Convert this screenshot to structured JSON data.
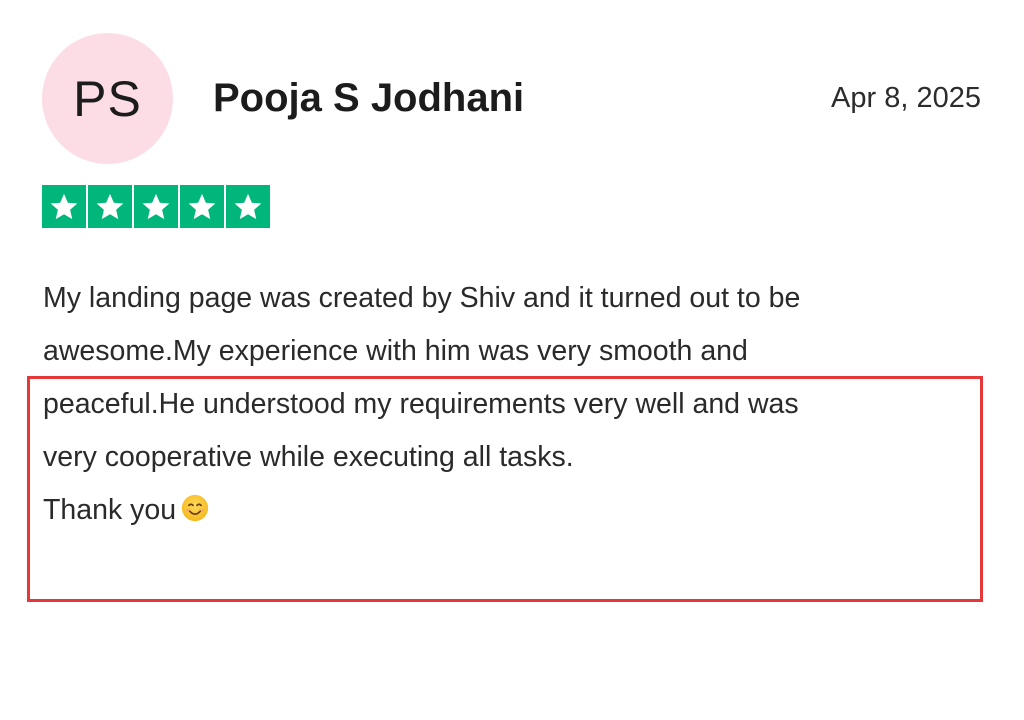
{
  "reviewer": {
    "initials": "PS",
    "name": "Pooja S Jodhani",
    "avatar_color": "#fcdde6"
  },
  "review": {
    "date": "Apr 8, 2025",
    "rating": 5,
    "rating_max": 5,
    "star_color": "#00b67a",
    "lines": [
      "My landing page was created by Shiv and it turned out to be",
      "awesome.My experience with him was very smooth and",
      "peaceful.He understood my requirements very well and was",
      "very cooperative while executing all tasks.",
      "Thank you"
    ],
    "closing_emoji": "smiling-face-icon"
  },
  "highlight": {
    "color": "#e53838"
  }
}
